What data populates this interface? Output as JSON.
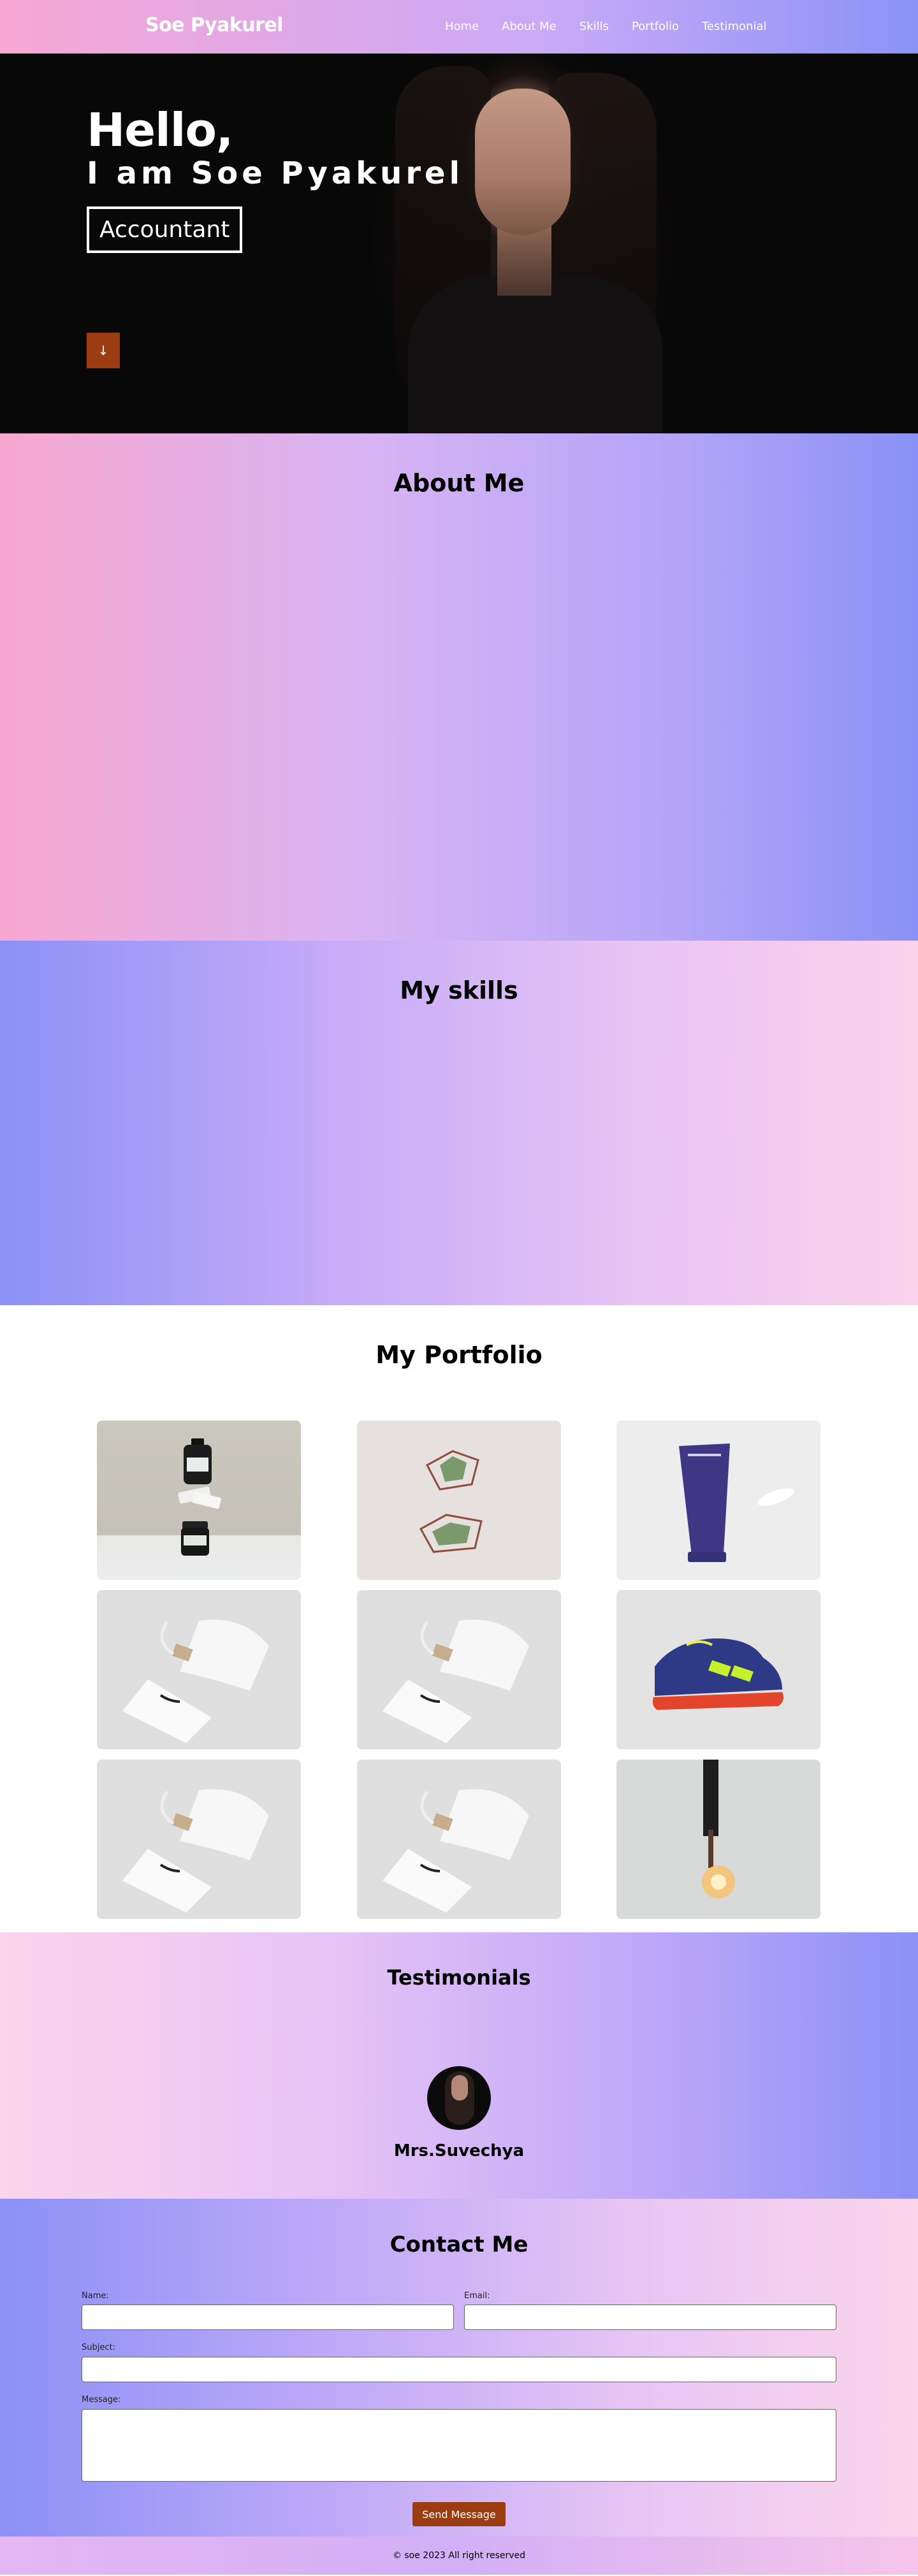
{
  "nav": {
    "brand": "Soe Pyakurel",
    "links": [
      "Home",
      "About Me",
      "Skills",
      "Portfolio",
      "Testimonial"
    ]
  },
  "hero": {
    "greeting": "Hello,",
    "intro": "I am Soe Pyakurel",
    "role": "Accountant",
    "down_arrow": "↓"
  },
  "about": {
    "title": "About Me"
  },
  "skills": {
    "title": "My skills"
  },
  "portfolio": {
    "title": "My Portfolio"
  },
  "testimonials": {
    "title": "Testimonials",
    "name": "Mrs.Suvechya"
  },
  "contact": {
    "title": "Contact Me",
    "name_label": "Name:",
    "email_label": "Email:",
    "subject_label": "Subject:",
    "message_label": "Message:",
    "send_label": "Send Message"
  },
  "footer": {
    "text": "© soe 2023 All right reserved"
  },
  "colors": {
    "accent": "#9c3d11",
    "pink": "#f8a8d0",
    "violet": "#8b91f6"
  }
}
